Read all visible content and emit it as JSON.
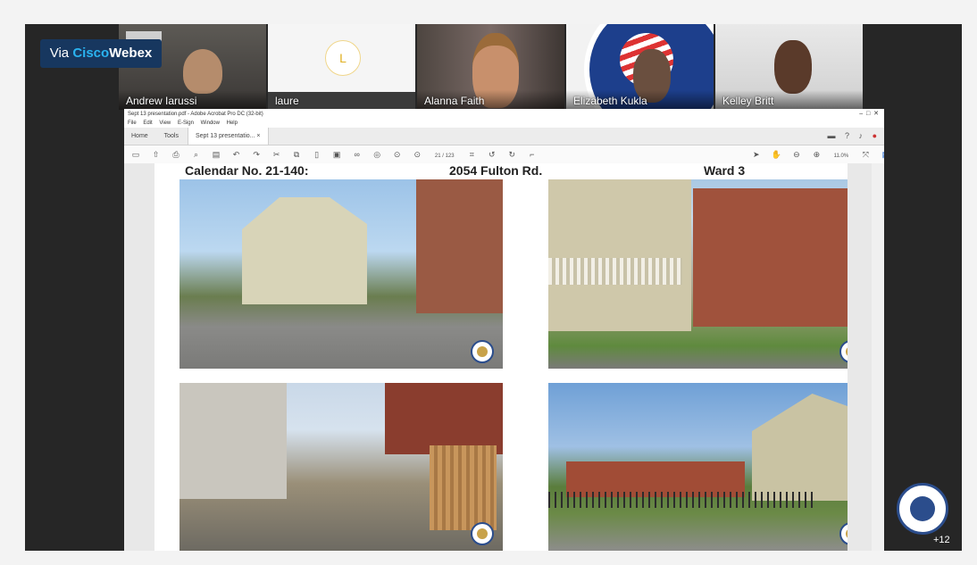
{
  "webex_label": {
    "prefix": "Via ",
    "brand": "Cisco",
    "brand2": "Webex"
  },
  "participants": [
    {
      "name": "Andrew Iarussi"
    },
    {
      "name": "laure",
      "initial": "L"
    },
    {
      "name": "Alanna Faith"
    },
    {
      "name": "Elizabeth Kukla"
    },
    {
      "name": "Kelley Britt"
    }
  ],
  "acrobat": {
    "title": "Sept 13 presentation.pdf - Adobe Acrobat Pro DC (32-bit)",
    "menu": [
      "File",
      "Edit",
      "View",
      "E-Sign",
      "Window",
      "Help"
    ],
    "tabs": {
      "home": "Home",
      "tools": "Tools",
      "doc": "Sept 13 presentatio... ×"
    },
    "page_indicator": "21 / 123",
    "zoom": "11.0%"
  },
  "slide": {
    "calendar": "Calendar No. 21-140:",
    "address": "2054 Fulton Rd.",
    "ward": "Ward 3"
  },
  "others_count": "+12",
  "icons": [
    "gear-icon",
    "search-icon",
    "hand-icon",
    "zoom-out-icon",
    "zoom-in-icon",
    "comment-icon",
    "pen-icon",
    "share-icon",
    "help-icon",
    "bell-icon"
  ]
}
